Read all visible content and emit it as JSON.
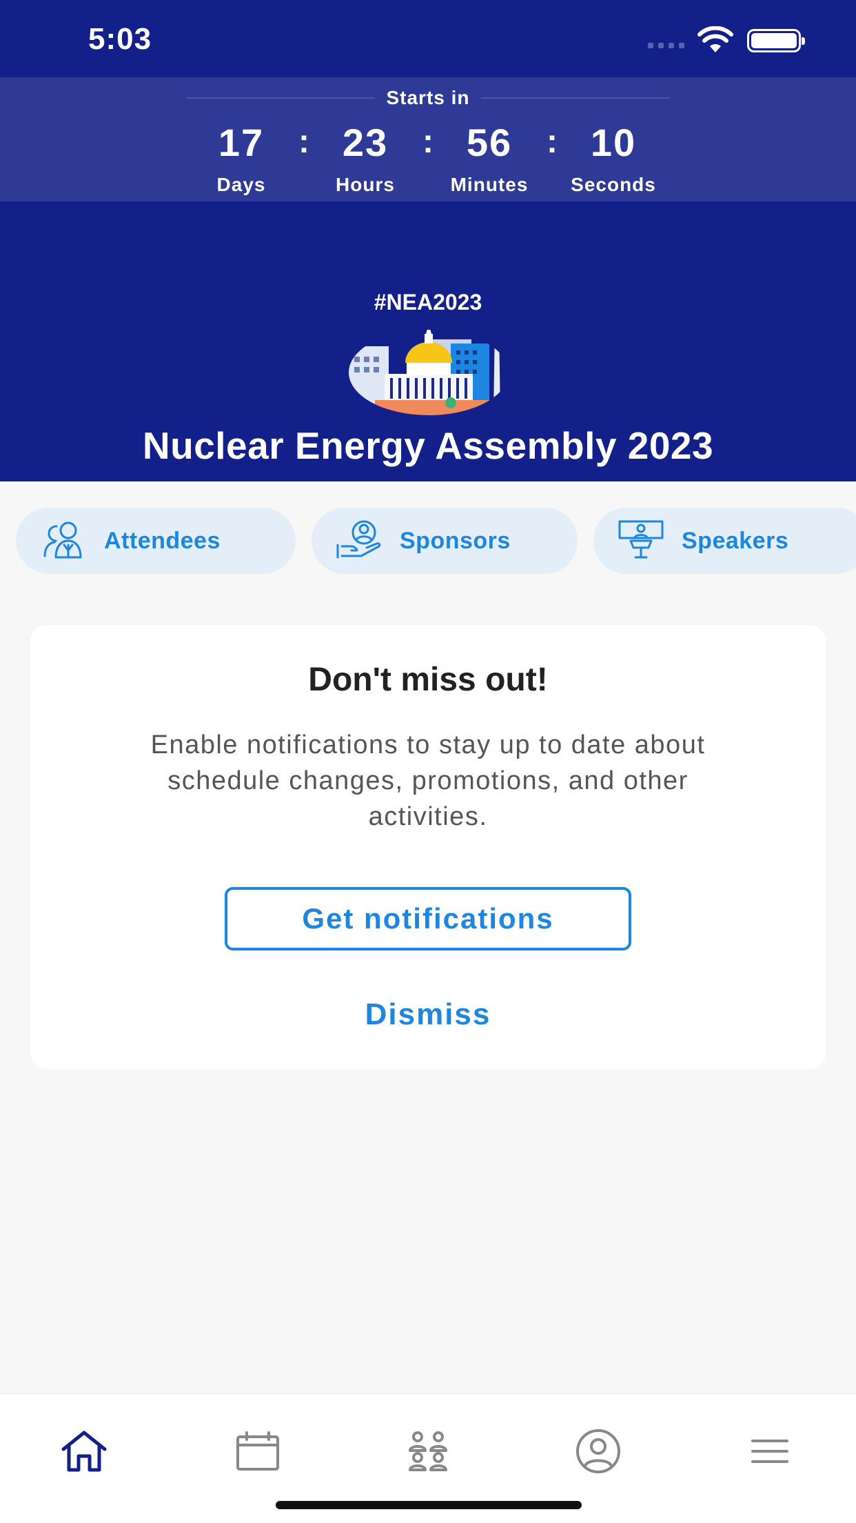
{
  "status_bar": {
    "time": "5:03"
  },
  "countdown": {
    "heading": "Starts in",
    "units": [
      {
        "value": "17",
        "label": "Days"
      },
      {
        "value": "23",
        "label": "Hours"
      },
      {
        "value": "56",
        "label": "Minutes"
      },
      {
        "value": "10",
        "label": "Seconds"
      }
    ],
    "separator": ":"
  },
  "event": {
    "hashtag": "#NEA2023",
    "title": "Nuclear Energy Assembly 2023"
  },
  "quick_links": [
    {
      "label": "Attendees",
      "icon": "attendees-icon"
    },
    {
      "label": "Sponsors",
      "icon": "sponsors-icon"
    },
    {
      "label": "Speakers",
      "icon": "speakers-icon"
    }
  ],
  "notification_card": {
    "title": "Don't miss out!",
    "body": "Enable notifications to stay up to date about schedule changes, promotions, and other activities.",
    "primary_button": "Get notifications",
    "secondary_button": "Dismiss"
  },
  "tab_bar": {
    "items": [
      {
        "icon": "home-icon",
        "active": true
      },
      {
        "icon": "calendar-icon",
        "active": false
      },
      {
        "icon": "people-icon",
        "active": false
      },
      {
        "icon": "profile-icon",
        "active": false
      },
      {
        "icon": "menu-icon",
        "active": false
      }
    ]
  },
  "colors": {
    "header_bg": "#13208a",
    "countdown_bg": "#2e3a96",
    "accent": "#1d86e0",
    "pill_bg": "#e3eef9",
    "page_bg": "#f7f7f7"
  }
}
